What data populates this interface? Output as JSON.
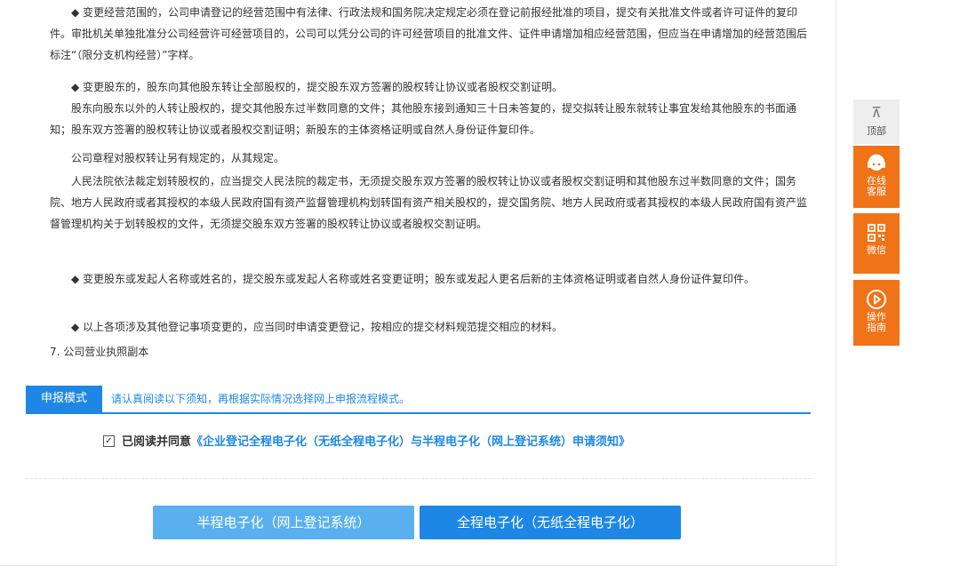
{
  "notes": {
    "p1": "◆ 变更经营范围的，公司申请登记的经营范围中有法律、行政法规和国务院决定规定必须在登记前报经批准的项目，提交有关批准文件或者许可证件的复印件。审批机关单独批准分公司经营许可经营项目的，公司可以凭分公司的许可经营项目的批准文件、证件申请增加相应经营范围，但应当在申请增加的经营范围后标注“（限分支机构经营）”字样。",
    "p2": "◆ 变更股东的，股东向其他股东转让全部股权的，提交股东双方签署的股权转让协议或者股权交割证明。",
    "p3": "股东向股东以外的人转让股权的，提交其他股东过半数同意的文件；其他股东接到通知三十日未答复的，提交拟转让股东就转让事宜发给其他股东的书面通知；股东双方签署的股权转让协议或者股权交割证明；新股东的主体资格证明或自然人身份证件复印件。",
    "p4": "公司章程对股权转让另有规定的，从其规定。",
    "p5": "人民法院依法裁定划转股权的，应当提交人民法院的裁定书，无须提交股东双方签署的股权转让协议或者股权交割证明和其他股东过半数同意的文件；国务院、地方人民政府或者其授权的本级人民政府国有资产监督管理机构划转国有资产相关股权的，提交国务院、地方人民政府或者其授权的本级人民政府国有资产监督管理机构关于划转股权的文件，无须提交股东双方签署的股权转让协议或者股权交割证明。",
    "p6": "◆ 变更股东或发起人名称或姓名的，提交股东或发起人名称或姓名变更证明；股东或发起人更名后新的主体资格证明或者自然人身份证件复印件。",
    "p7": "◆ 以上各项涉及其他登记事项变更的，应当同时申请变更登记，按相应的提交材料规范提交相应的材料。",
    "item7": "7.  公司营业执照副本"
  },
  "mode": {
    "tag": "申报模式",
    "tip": "请认真阅读以下须知，再根据实际情况选择网上申报流程模式。"
  },
  "agree": {
    "checked_mark": "✓",
    "prefix": "已阅读并同意",
    "link": "《企业登记全程电子化（无纸全程电子化）与半程电子化（网上登记系统）申请须知》"
  },
  "buttons": {
    "half": "半程电子化（网上登记系统）",
    "full": "全程电子化（无纸全程电子化）"
  },
  "sidebar": {
    "top_arrow": "⊼",
    "top": "顶部",
    "service_line1": "在线",
    "service_line2": "客服",
    "wechat": "微信",
    "guide_line1": "操作",
    "guide_line2": "指南"
  },
  "colors": {
    "accent": "#1e87e6",
    "button_light": "#5ab0ee",
    "sidebar_orange": "#f07318"
  }
}
